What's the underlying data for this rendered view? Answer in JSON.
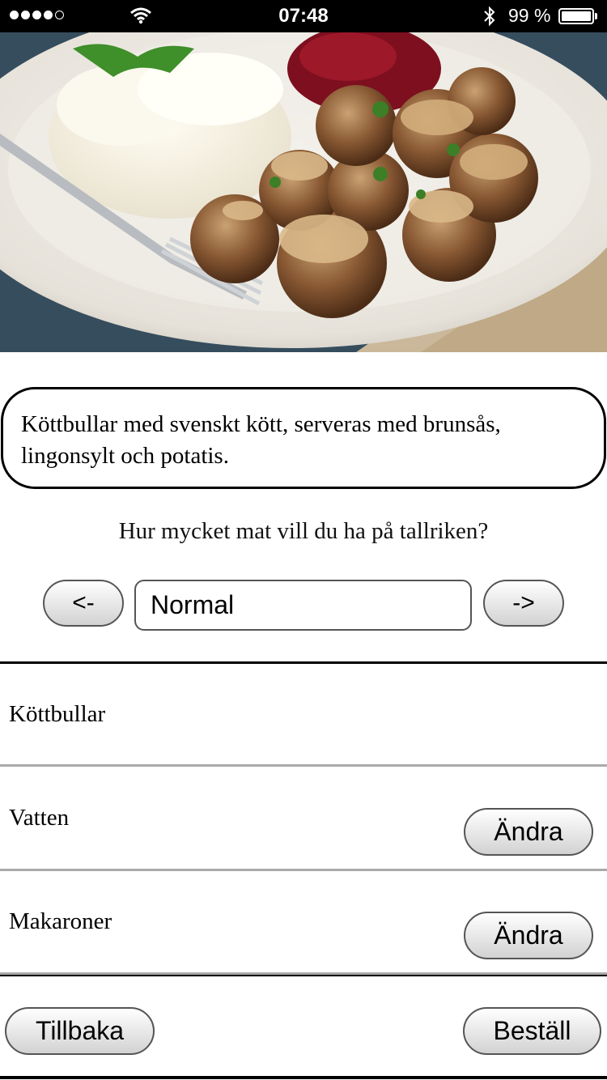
{
  "status_bar": {
    "time": "07:48",
    "battery": "99 %"
  },
  "dish": {
    "image": "meatballs-plate",
    "description": "Köttbullar med svenskt kött, serveras med brunsås, lingonsylt och potatis."
  },
  "portion": {
    "question": "Hur mycket mat vill du ha på tallriken?",
    "prev_label": "<-",
    "value": "Normal",
    "next_label": "->"
  },
  "items": [
    {
      "name": "Köttbullar"
    },
    {
      "name": "Vatten",
      "action": "Ändra"
    },
    {
      "name": "Makaroner",
      "action": "Ändra"
    }
  ],
  "footer": {
    "back_label": "Tillbaka",
    "order_label": "Beställ"
  }
}
